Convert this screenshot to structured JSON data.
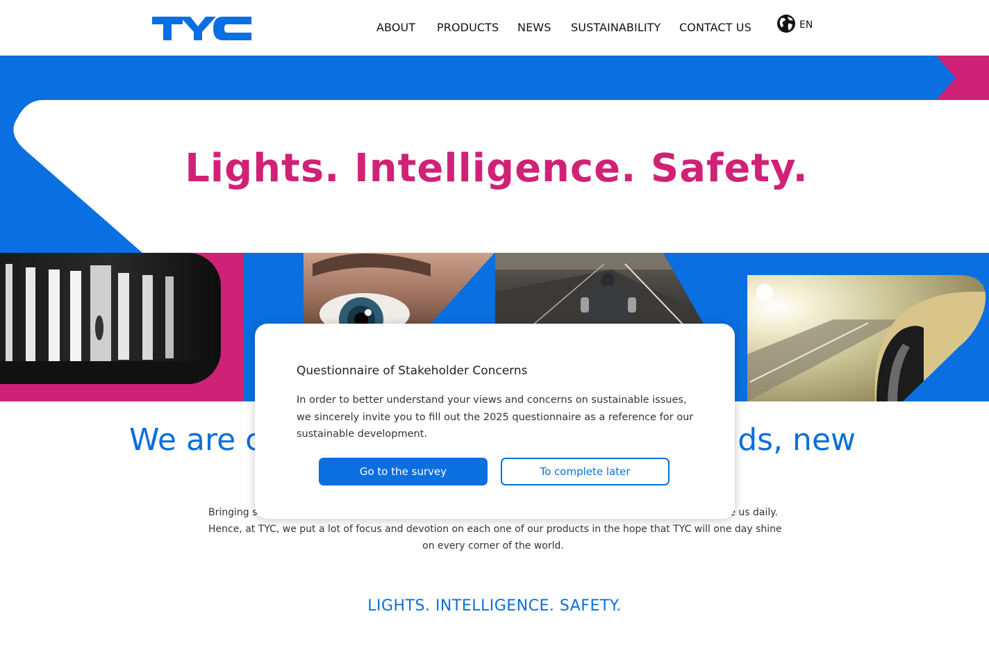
{
  "header": {
    "logo_text": "TYC",
    "nav": [
      {
        "label": "ABOUT"
      },
      {
        "label": "PRODUCTS"
      },
      {
        "label": "NEWS"
      },
      {
        "label": "SUSTAINABILITY"
      },
      {
        "label": "CONTACT US"
      }
    ],
    "language": "EN"
  },
  "hero": {
    "title": "Lights. Intelligence. Safety."
  },
  "main": {
    "headline_left": "We are c",
    "headline_right": "lds, new",
    "paragraph_line1_left": "Bringing s",
    "paragraph_line1_right": "e us daily.",
    "paragraph_line2": "Hence, at TYC, we put a lot of focus and devotion on each one of our products in the hope that TYC will one day shine",
    "paragraph_line3": "on every corner of the world.",
    "tagline": "LIGHTS. INTELLIGENCE. SAFETY."
  },
  "modal": {
    "title": "Questionnaire of Stakeholder Concerns",
    "text": "In order to better understand your views and concerns on sustainable issues, we sincerely invite you to fill out the 2025 questionnaire as a reference for our sustainable development.",
    "primary_button": "Go to the survey",
    "secondary_button": "To complete later"
  },
  "colors": {
    "brand_blue": "#0a6fe0",
    "brand_magenta": "#cf2277"
  },
  "icons": {
    "language": "globe-icon"
  }
}
